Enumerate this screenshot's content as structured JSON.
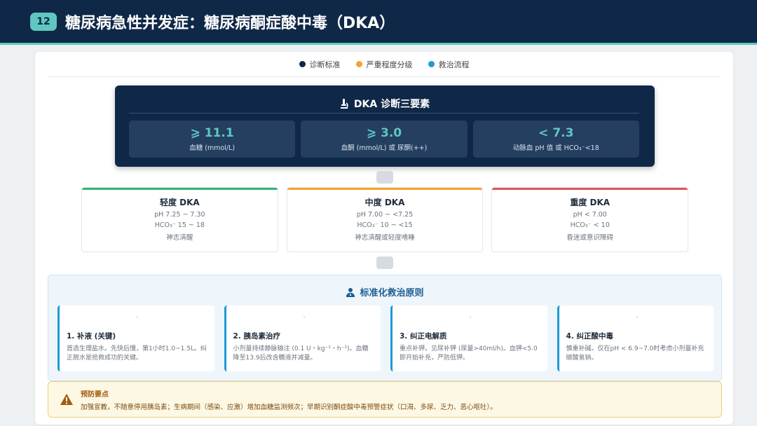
{
  "header": {
    "number": "12",
    "title": "糖尿病急性并发症：糖尿病酮症酸中毒（DKA）"
  },
  "legend": [
    {
      "label": "诊断标准",
      "color": "#0f2847"
    },
    {
      "label": "严重程度分级",
      "color": "#f2a42a"
    },
    {
      "label": "救治流程",
      "color": "#1e9ad6"
    }
  ],
  "diagnosis": {
    "title": "DKA 诊断三要素",
    "icon": "microscope-icon",
    "criteria": [
      {
        "value": "⩾ 11.1",
        "label": "血糖 (mmol/L)"
      },
      {
        "value": "⩾ 3.0",
        "label": "血酮 (mmol/L) 或 尿酮(++)"
      },
      {
        "value": "< 7.3",
        "label": "动脉血 pH 值 或 HCO₃⁻<18"
      }
    ]
  },
  "severity": [
    {
      "name": "轻度 DKA",
      "color": "#2fb874",
      "lines": [
        "pH 7.25 ~ 7.30",
        "HCO₃⁻ 15 ~ 18",
        "神志清醒"
      ]
    },
    {
      "name": "中度 DKA",
      "color": "#f2a42a",
      "lines": [
        "pH 7.00 ~ <7.25",
        "HCO₃⁻ 10 ~ <15",
        "神志清醒或轻度嗜睡"
      ]
    },
    {
      "name": "重度 DKA",
      "color": "#e05656",
      "lines": [
        "pH < 7.00",
        "HCO₃⁻ < 10",
        "昏迷或意识障碍"
      ]
    }
  ],
  "treatment": {
    "title": "标准化救治原则",
    "icon": "doctor-icon",
    "steps": [
      {
        "title": "1. 补液 (关键)",
        "desc": "首选生理盐水。先快后慢，第1小时1.0~1.5L。纠正脱水是抢救成功的关键。"
      },
      {
        "title": "2. 胰岛素治疗",
        "desc": "小剂量持续静脉输注 (0.1 U・kg⁻¹・h⁻¹)。血糖降至13.9后改含糖液并减量。"
      },
      {
        "title": "3. 纠正电解质",
        "desc": "重点补钾。见尿补钾 (尿量>40ml/h)。血钾<5.0即开始补充，严防低钾。"
      },
      {
        "title": "4. 纠正酸中毒",
        "desc": "慎重补碱。仅在pH < 6.9~7.0时考虑小剂量补充碳酸氢钠。"
      }
    ]
  },
  "prevention": {
    "title": "预防要点",
    "icon": "warning-icon",
    "text": "加强宣教，不随意停用胰岛素；生病期间（感染、应激）增加血糖监测频次；早期识别酮症酸中毒预警症状（口渴、多尿、乏力、恶心呕吐）。"
  }
}
